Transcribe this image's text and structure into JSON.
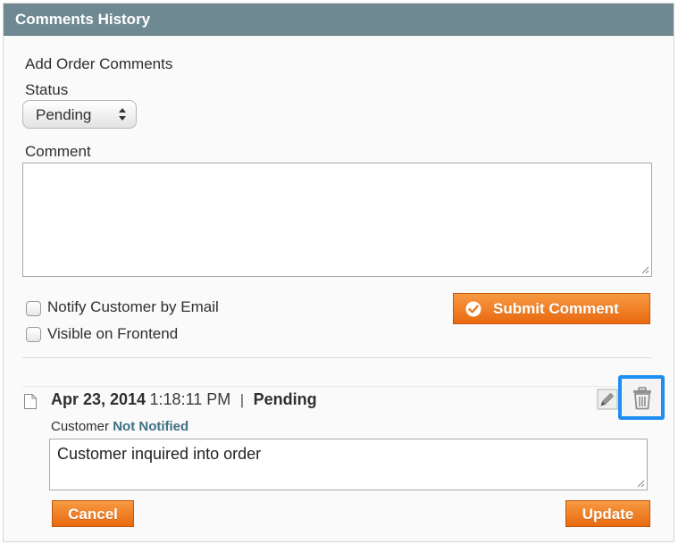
{
  "panel": {
    "title": "Comments History"
  },
  "form": {
    "heading": "Add Order Comments",
    "status_label": "Status",
    "status_value": "Pending",
    "comment_label": "Comment",
    "comment_value": "",
    "notify_label": "Notify Customer by Email",
    "notify_checked": false,
    "visible_label": "Visible on Frontend",
    "visible_checked": false,
    "submit_label": "Submit Comment"
  },
  "history": {
    "entries": [
      {
        "date": "Apr 23, 2014",
        "time": "1:18:11 PM",
        "separator": "|",
        "status": "Pending",
        "customer_label": "Customer",
        "notified_value": "Not Notified",
        "comment": "Customer inquired into order",
        "cancel_label": "Cancel",
        "update_label": "Update"
      }
    ]
  },
  "icons": {
    "select_arrows": "chevron-up-down-icon",
    "submit": "check-circle-icon",
    "document": "document-icon",
    "edit": "pencil-icon",
    "delete": "trash-icon",
    "resize": "resize-handle-icon"
  },
  "colors": {
    "header_bg": "#6f8992",
    "accent_orange": "#ef7b22",
    "notified_text": "#3f6f82",
    "highlight_blue": "#1f8ef1"
  }
}
